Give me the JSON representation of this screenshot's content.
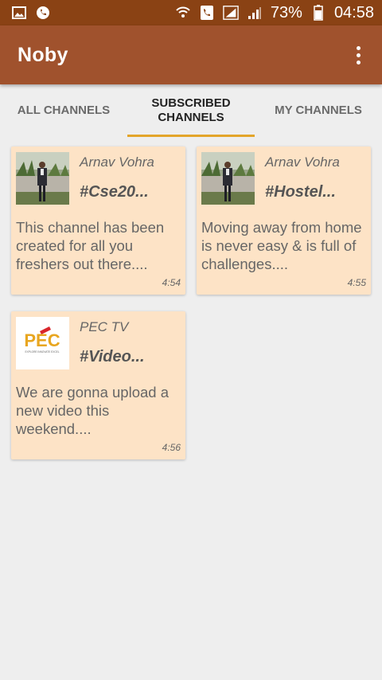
{
  "status_bar": {
    "battery_percent": "73%",
    "time": "04:58"
  },
  "app_bar": {
    "title": "Noby"
  },
  "tabs": [
    {
      "label": "ALL CHANNELS",
      "active": false
    },
    {
      "label": "SUBSCRIBED\nCHANNELS",
      "active": true
    },
    {
      "label": "MY CHANNELS",
      "active": false
    }
  ],
  "cards": [
    {
      "author": "Arnav Vohra",
      "hashtag": "#Cse20...",
      "description": "This channel has been created for all you freshers out there....",
      "time": "4:54"
    },
    {
      "author": "Arnav Vohra",
      "hashtag": "#Hostel...",
      "description": "Moving away from home is never easy & is full of challenges....",
      "time": "4:55"
    },
    {
      "author": "PEC TV",
      "hashtag": "#Video...",
      "description": "We are gonna upload a new video this weekend....",
      "time": "4:56"
    }
  ],
  "logos": {
    "pec_text": "PEC",
    "pec_tagline": "EXPLORE INNOVATE EXCEL"
  },
  "colors": {
    "status_bar": "#8a4214",
    "app_bar": "#a0522d",
    "tab_indicator": "#e3a52a",
    "card_bg": "#fde3c6",
    "background": "#eeeeee"
  }
}
